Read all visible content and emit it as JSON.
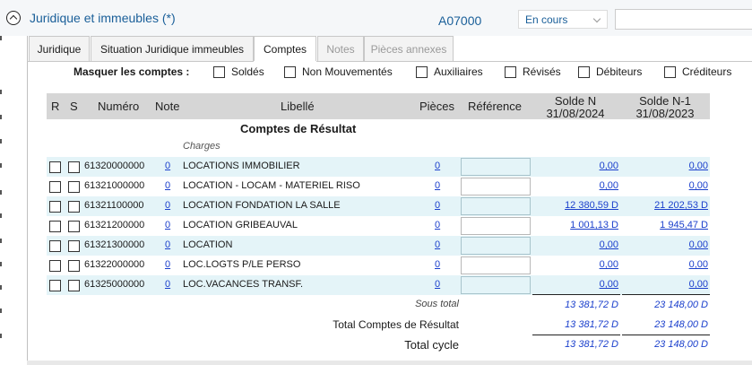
{
  "header": {
    "title": "Juridique et immeubles (*)",
    "code": "A07000",
    "status": "En cours",
    "search_value": ""
  },
  "tabs": [
    {
      "label": "Juridique",
      "state": "normal"
    },
    {
      "label": "Situation Juridique immeubles",
      "state": "normal"
    },
    {
      "label": "Comptes",
      "state": "active"
    },
    {
      "label": "Notes",
      "state": "disabled"
    },
    {
      "label": "Pièces annexes",
      "state": "disabled"
    }
  ],
  "filters": {
    "label": "Masquer les comptes :",
    "options": [
      {
        "label": "Soldés",
        "checked": false
      },
      {
        "label": "Non Mouvementés",
        "checked": false
      },
      {
        "label": "Auxiliaires",
        "checked": false
      },
      {
        "label": "Révisés",
        "checked": false
      },
      {
        "label": "Débiteurs",
        "checked": false
      },
      {
        "label": "Créditeurs",
        "checked": false
      }
    ]
  },
  "table": {
    "headers": {
      "r": "R",
      "s": "S",
      "numero": "Numéro",
      "note": "Note",
      "libelle": "Libellé",
      "pieces": "Pièces",
      "reference": "Référence",
      "solde_n_line1": "Solde N",
      "solde_n_line2": "31/08/2024",
      "solde_n1_line1": "Solde N-1",
      "solde_n1_line2": "31/08/2023"
    },
    "section_title": "Comptes de Résultat",
    "subcategory": "Charges",
    "rows": [
      {
        "numero": "61320000000",
        "note": "0",
        "libelle": "LOCATIONS IMMOBILIER",
        "pieces": "0",
        "solde_n": "0,00",
        "solde_n1": "0,00"
      },
      {
        "numero": "61321000000",
        "note": "0",
        "libelle": "LOCATION - LOCAM - MATERIEL RISO",
        "pieces": "0",
        "solde_n": "0,00",
        "solde_n1": "0,00"
      },
      {
        "numero": "61321100000",
        "note": "0",
        "libelle": "LOCATION FONDATION LA SALLE",
        "pieces": "0",
        "solde_n": "12 380,59 D",
        "solde_n1": "21 202,53 D"
      },
      {
        "numero": "61321200000",
        "note": "0",
        "libelle": "LOCATION GRIBEAUVAL",
        "pieces": "0",
        "solde_n": "1 001,13 D",
        "solde_n1": "1 945,47 D"
      },
      {
        "numero": "61321300000",
        "note": "0",
        "libelle": "LOCATION",
        "pieces": "0",
        "solde_n": "0,00",
        "solde_n1": "0,00"
      },
      {
        "numero": "61322000000",
        "note": "0",
        "libelle": "LOC.LOGTS P/LE PERSO",
        "pieces": "0",
        "solde_n": "0,00",
        "solde_n1": "0,00"
      },
      {
        "numero": "61325000000",
        "note": "0",
        "libelle": "LOC.VACANCES TRANSF.",
        "pieces": "0",
        "solde_n": "0,00",
        "solde_n1": "0,00"
      }
    ],
    "sous_total": {
      "label": "Sous total",
      "solde_n": "13 381,72 D",
      "solde_n1": "23 148,00 D"
    },
    "total_comptes": {
      "label": "Total Comptes de Résultat",
      "solde_n": "13 381,72 D",
      "solde_n1": "23 148,00 D"
    },
    "total_cycle": {
      "label": "Total cycle",
      "solde_n": "13 381,72 D",
      "solde_n1": "23 148,00 D"
    }
  }
}
